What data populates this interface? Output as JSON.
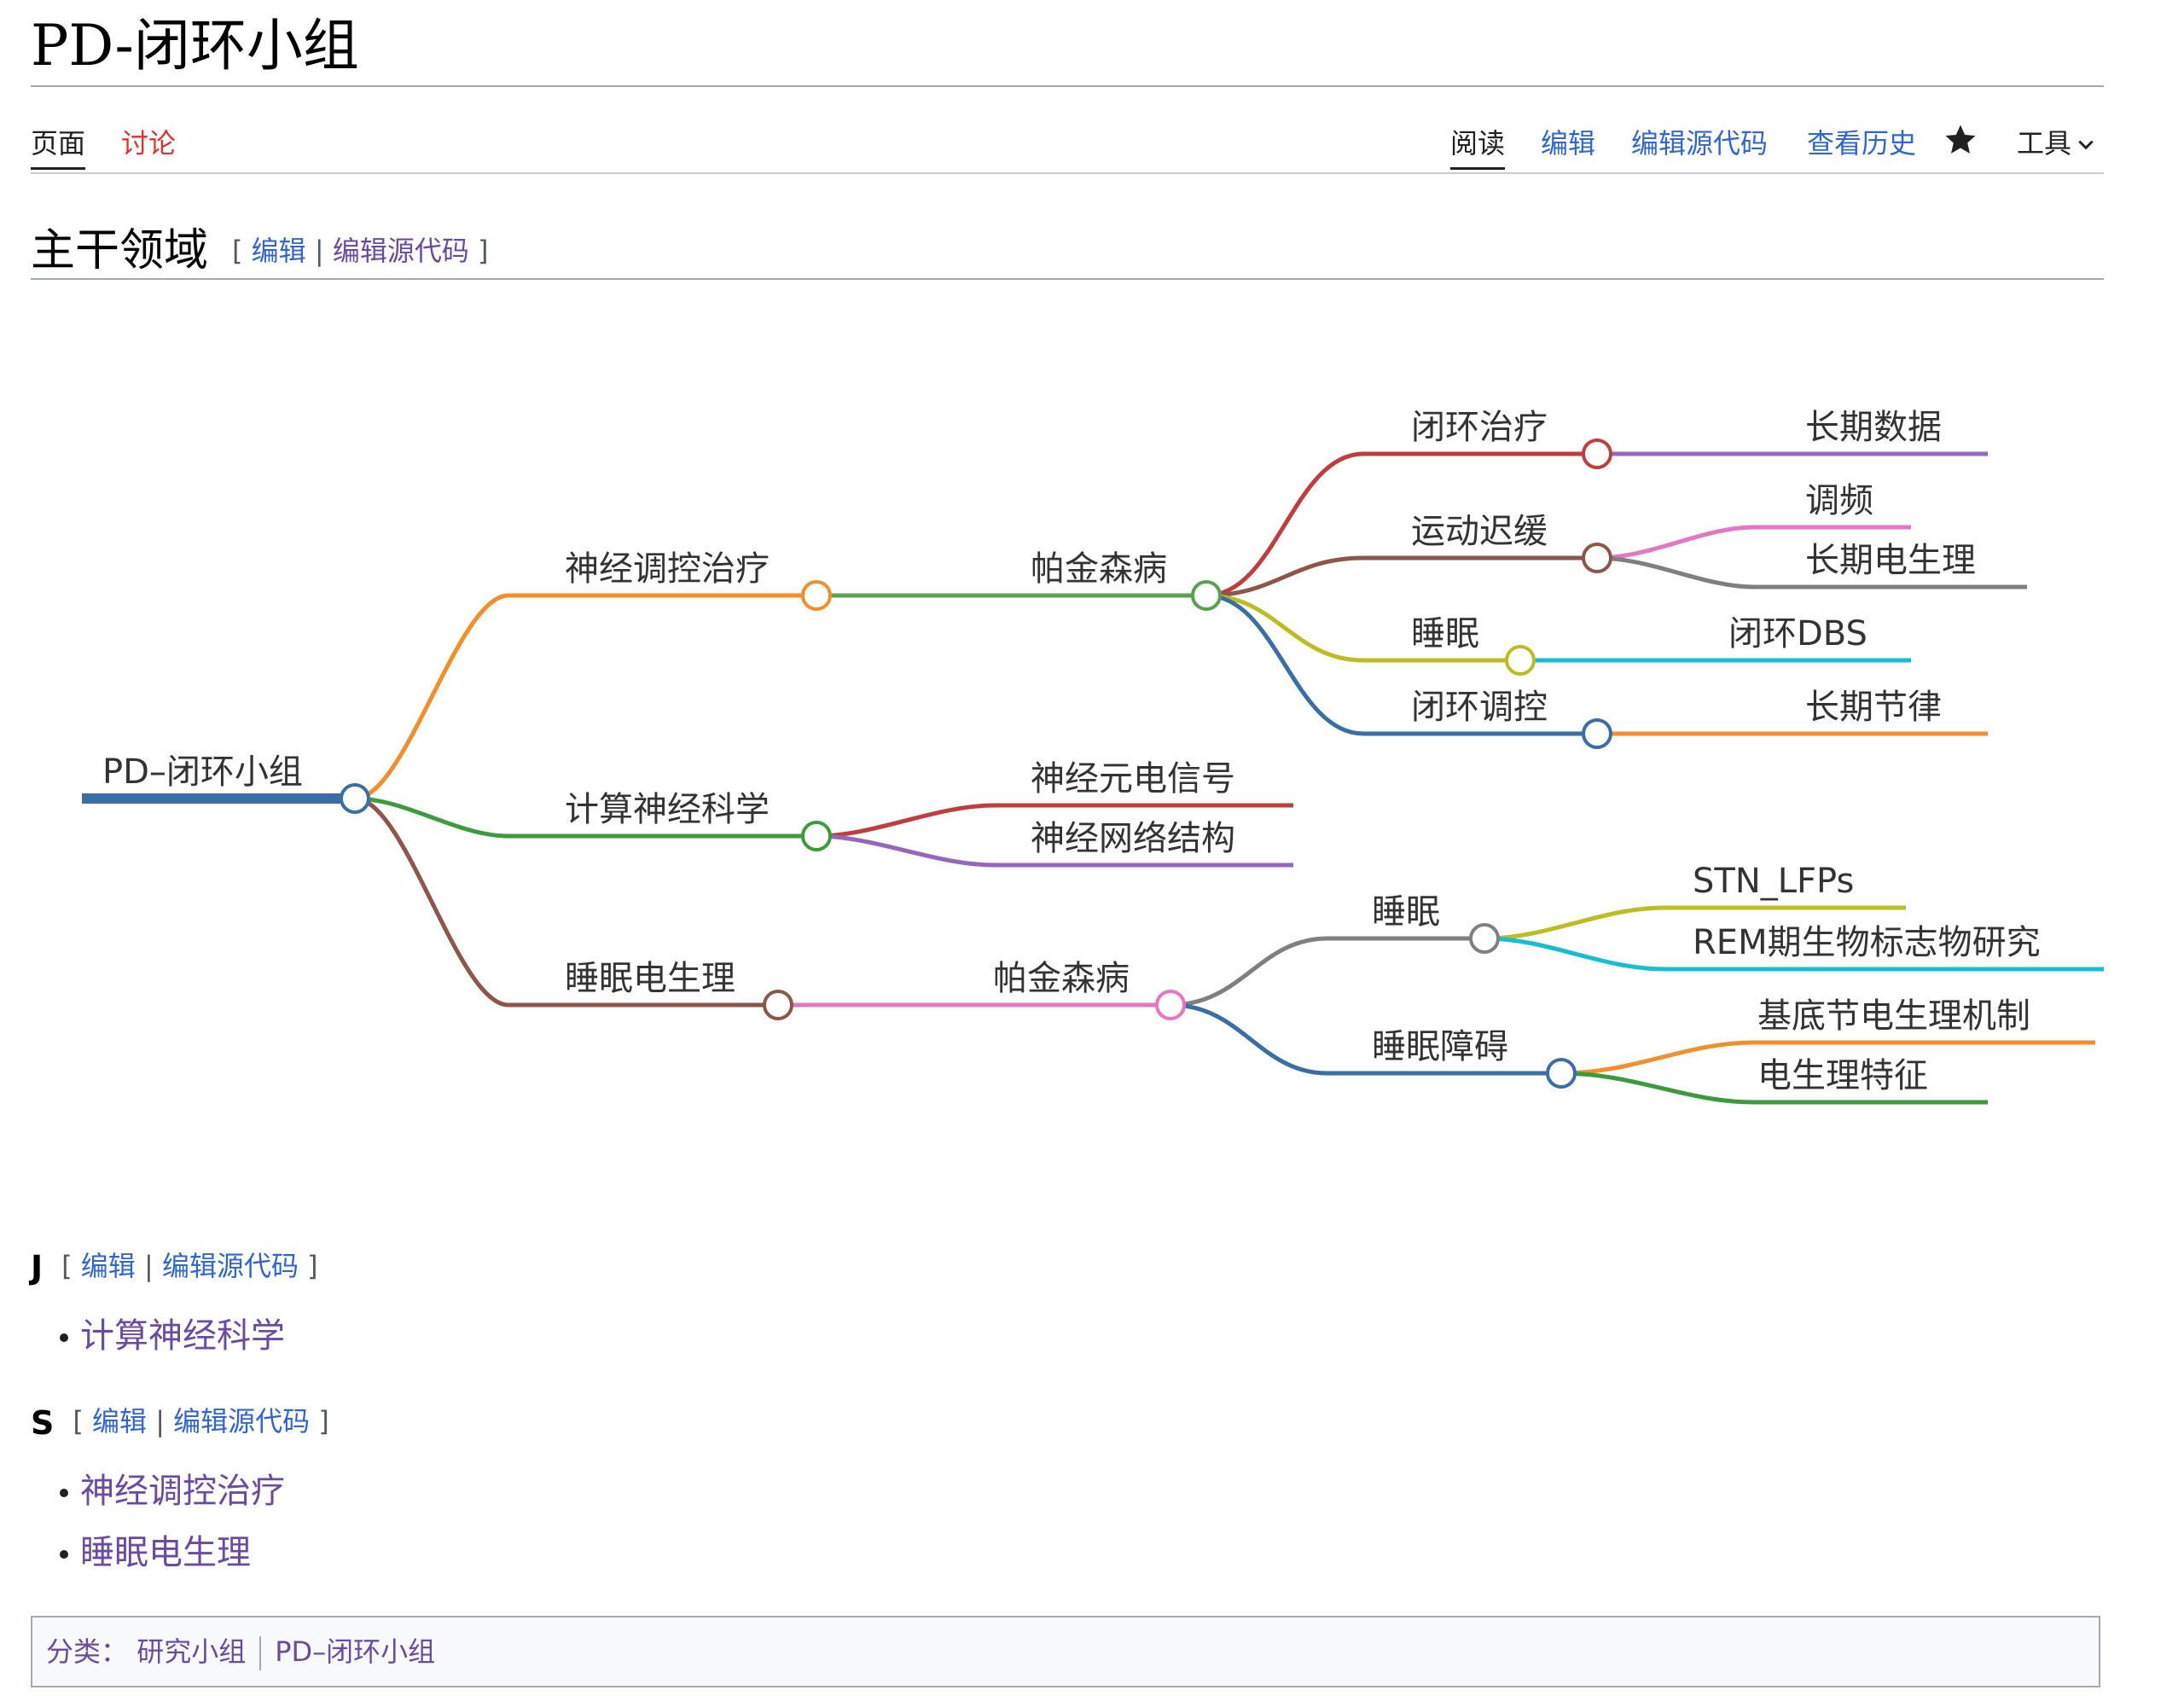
{
  "page": {
    "title": "PD-闭环小组"
  },
  "tabs": {
    "left": [
      {
        "label": "页面"
      },
      {
        "label": "讨论"
      }
    ],
    "right": [
      {
        "label": "阅读"
      },
      {
        "label": "编辑"
      },
      {
        "label": "编辑源代码"
      },
      {
        "label": "查看历史"
      }
    ],
    "watch_icon": "star-icon",
    "tools_label": "工具",
    "tools_icon": "chevron-down-icon"
  },
  "section": {
    "heading": "主干领域",
    "edit_label": "编辑",
    "edit_source_label": "编辑源代码"
  },
  "mindmap": {
    "root": {
      "label": "PD–闭环小组"
    },
    "nodes": [
      {
        "label": "神经调控治疗",
        "color": "#f28e2b"
      },
      {
        "label": "帕金森病",
        "color": "#59a14f"
      },
      {
        "label": "闭环治疗",
        "color": "#c03d3e"
      },
      {
        "label": "长期数据",
        "color": "#9467bd"
      },
      {
        "label": "运动迟缓",
        "color": "#8c564b"
      },
      {
        "label": "调频",
        "color": "#e377c2"
      },
      {
        "label": "长期电生理",
        "color": "#7f7f7f"
      },
      {
        "label": "睡眠",
        "color": "#bcbd22"
      },
      {
        "label": "闭环DBS",
        "color": "#17becf"
      },
      {
        "label": "闭环调控",
        "color": "#3a6ea5"
      },
      {
        "label": "长期节律",
        "color": "#f28e2b"
      },
      {
        "label": "计算神经科学",
        "color": "#3d9a3d"
      },
      {
        "label": "神经元电信号",
        "color": "#c03d3e"
      },
      {
        "label": "神经网络结构",
        "color": "#9467bd"
      },
      {
        "label": "睡眠电生理",
        "color": "#8c564b"
      },
      {
        "label": "帕金森病",
        "color": "#e377c2"
      },
      {
        "label": "睡眠",
        "color": "#7f7f7f"
      },
      {
        "label": "STN_LFPs",
        "color": "#bcbd22"
      },
      {
        "label": "REM期生物标志物研究",
        "color": "#17becf"
      },
      {
        "label": "睡眠障碍",
        "color": "#3a6ea5"
      },
      {
        "label": "基底节电生理机制",
        "color": "#f28e2b"
      },
      {
        "label": "电生理特征",
        "color": "#3d9a3d"
      }
    ]
  },
  "index": [
    {
      "letter": "J",
      "edit_label": "编辑",
      "edit_source_label": "编辑源代码",
      "items": [
        "计算神经科学"
      ]
    },
    {
      "letter": "S",
      "edit_label": "编辑",
      "edit_source_label": "编辑源代码",
      "items": [
        "神经调控治疗",
        "睡眠电生理"
      ]
    }
  ],
  "categories": {
    "label": "分类：",
    "items": [
      "研究小组",
      "PD–闭环小组"
    ]
  },
  "colors": {
    "link": "#3366cc",
    "visited_link": "#6b4ba1",
    "new_link": "#dd3333",
    "root_color": "#3a6ea5"
  }
}
